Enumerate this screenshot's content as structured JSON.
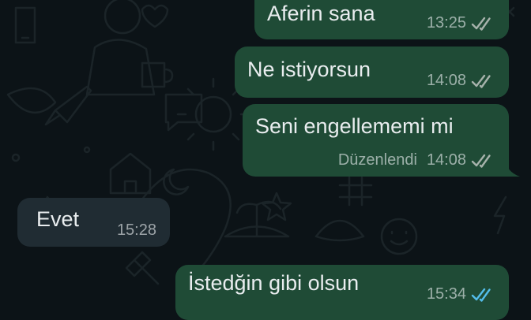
{
  "colors": {
    "background": "#0c1317",
    "outgoing_bubble": "#1f4b36",
    "incoming_bubble": "#202c33",
    "text": "#e9edef",
    "meta_text": "#9aa8a0",
    "ticks_delivered": "#a6b2ab",
    "ticks_read": "#53bdeb"
  },
  "messages": [
    {
      "direction": "outgoing",
      "text": "Aferin sana",
      "time": "13:25",
      "status_icon": "double-check-icon"
    },
    {
      "direction": "outgoing",
      "text": "Ne istiyorsun",
      "time": "14:08",
      "status_icon": "double-check-icon"
    },
    {
      "direction": "outgoing",
      "text": "Seni engellememi  mi",
      "edited_label": "Düzenlendi",
      "time": "14:08",
      "status_icon": "double-check-icon"
    },
    {
      "direction": "incoming",
      "text": "Evet",
      "time": "15:28"
    },
    {
      "direction": "outgoing",
      "text": "İstedğin gibi olsun",
      "time": "15:34",
      "status_icon": "double-check-read-icon"
    }
  ]
}
